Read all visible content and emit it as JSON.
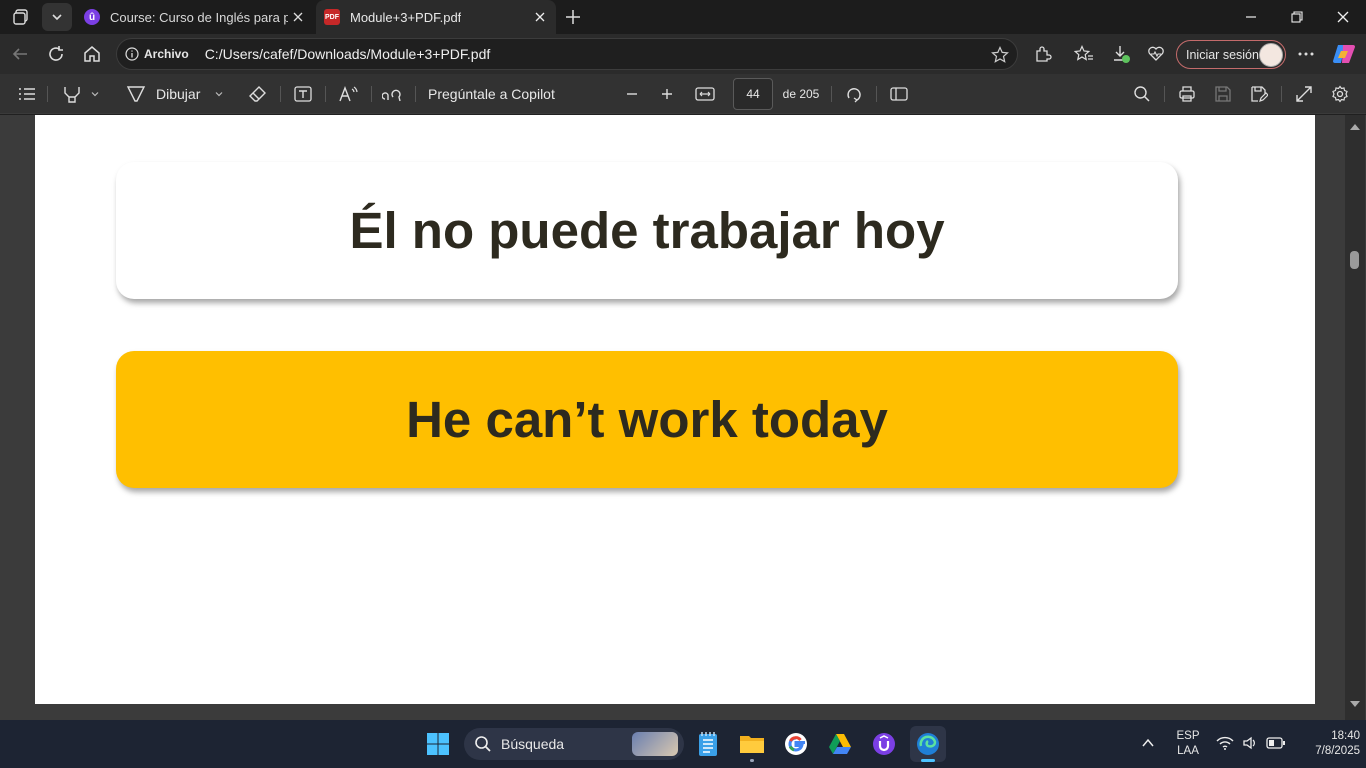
{
  "browser": {
    "tabs": [
      {
        "title": "Course: Curso de Inglés para principiantes",
        "active": false
      },
      {
        "title": "Module+3+PDF.pdf",
        "active": true
      }
    ],
    "address": {
      "chip_label": "Archivo",
      "url": "C:/Users/cafef/Downloads/Module+3+PDF.pdf"
    },
    "signin_label": "Iniciar sesión"
  },
  "pdf_toolbar": {
    "draw_label": "Dibujar",
    "copilot_label": "Pregúntale a Copilot",
    "page_current": "44",
    "page_total_label": "de 205"
  },
  "pdf_page": {
    "spanish_sentence": "Él no puede trabajar hoy",
    "english_sentence": "He can’t work today",
    "highlight_color": "#ffbf00"
  },
  "taskbar": {
    "search_placeholder": "Búsqueda",
    "language": "ESP",
    "layout": "LAA",
    "time": "18:40",
    "date": "7/8/2025"
  },
  "colors": {
    "tab_strip": "#1c1c1c",
    "toolbar": "#323232",
    "taskbar": "#1d2433"
  }
}
